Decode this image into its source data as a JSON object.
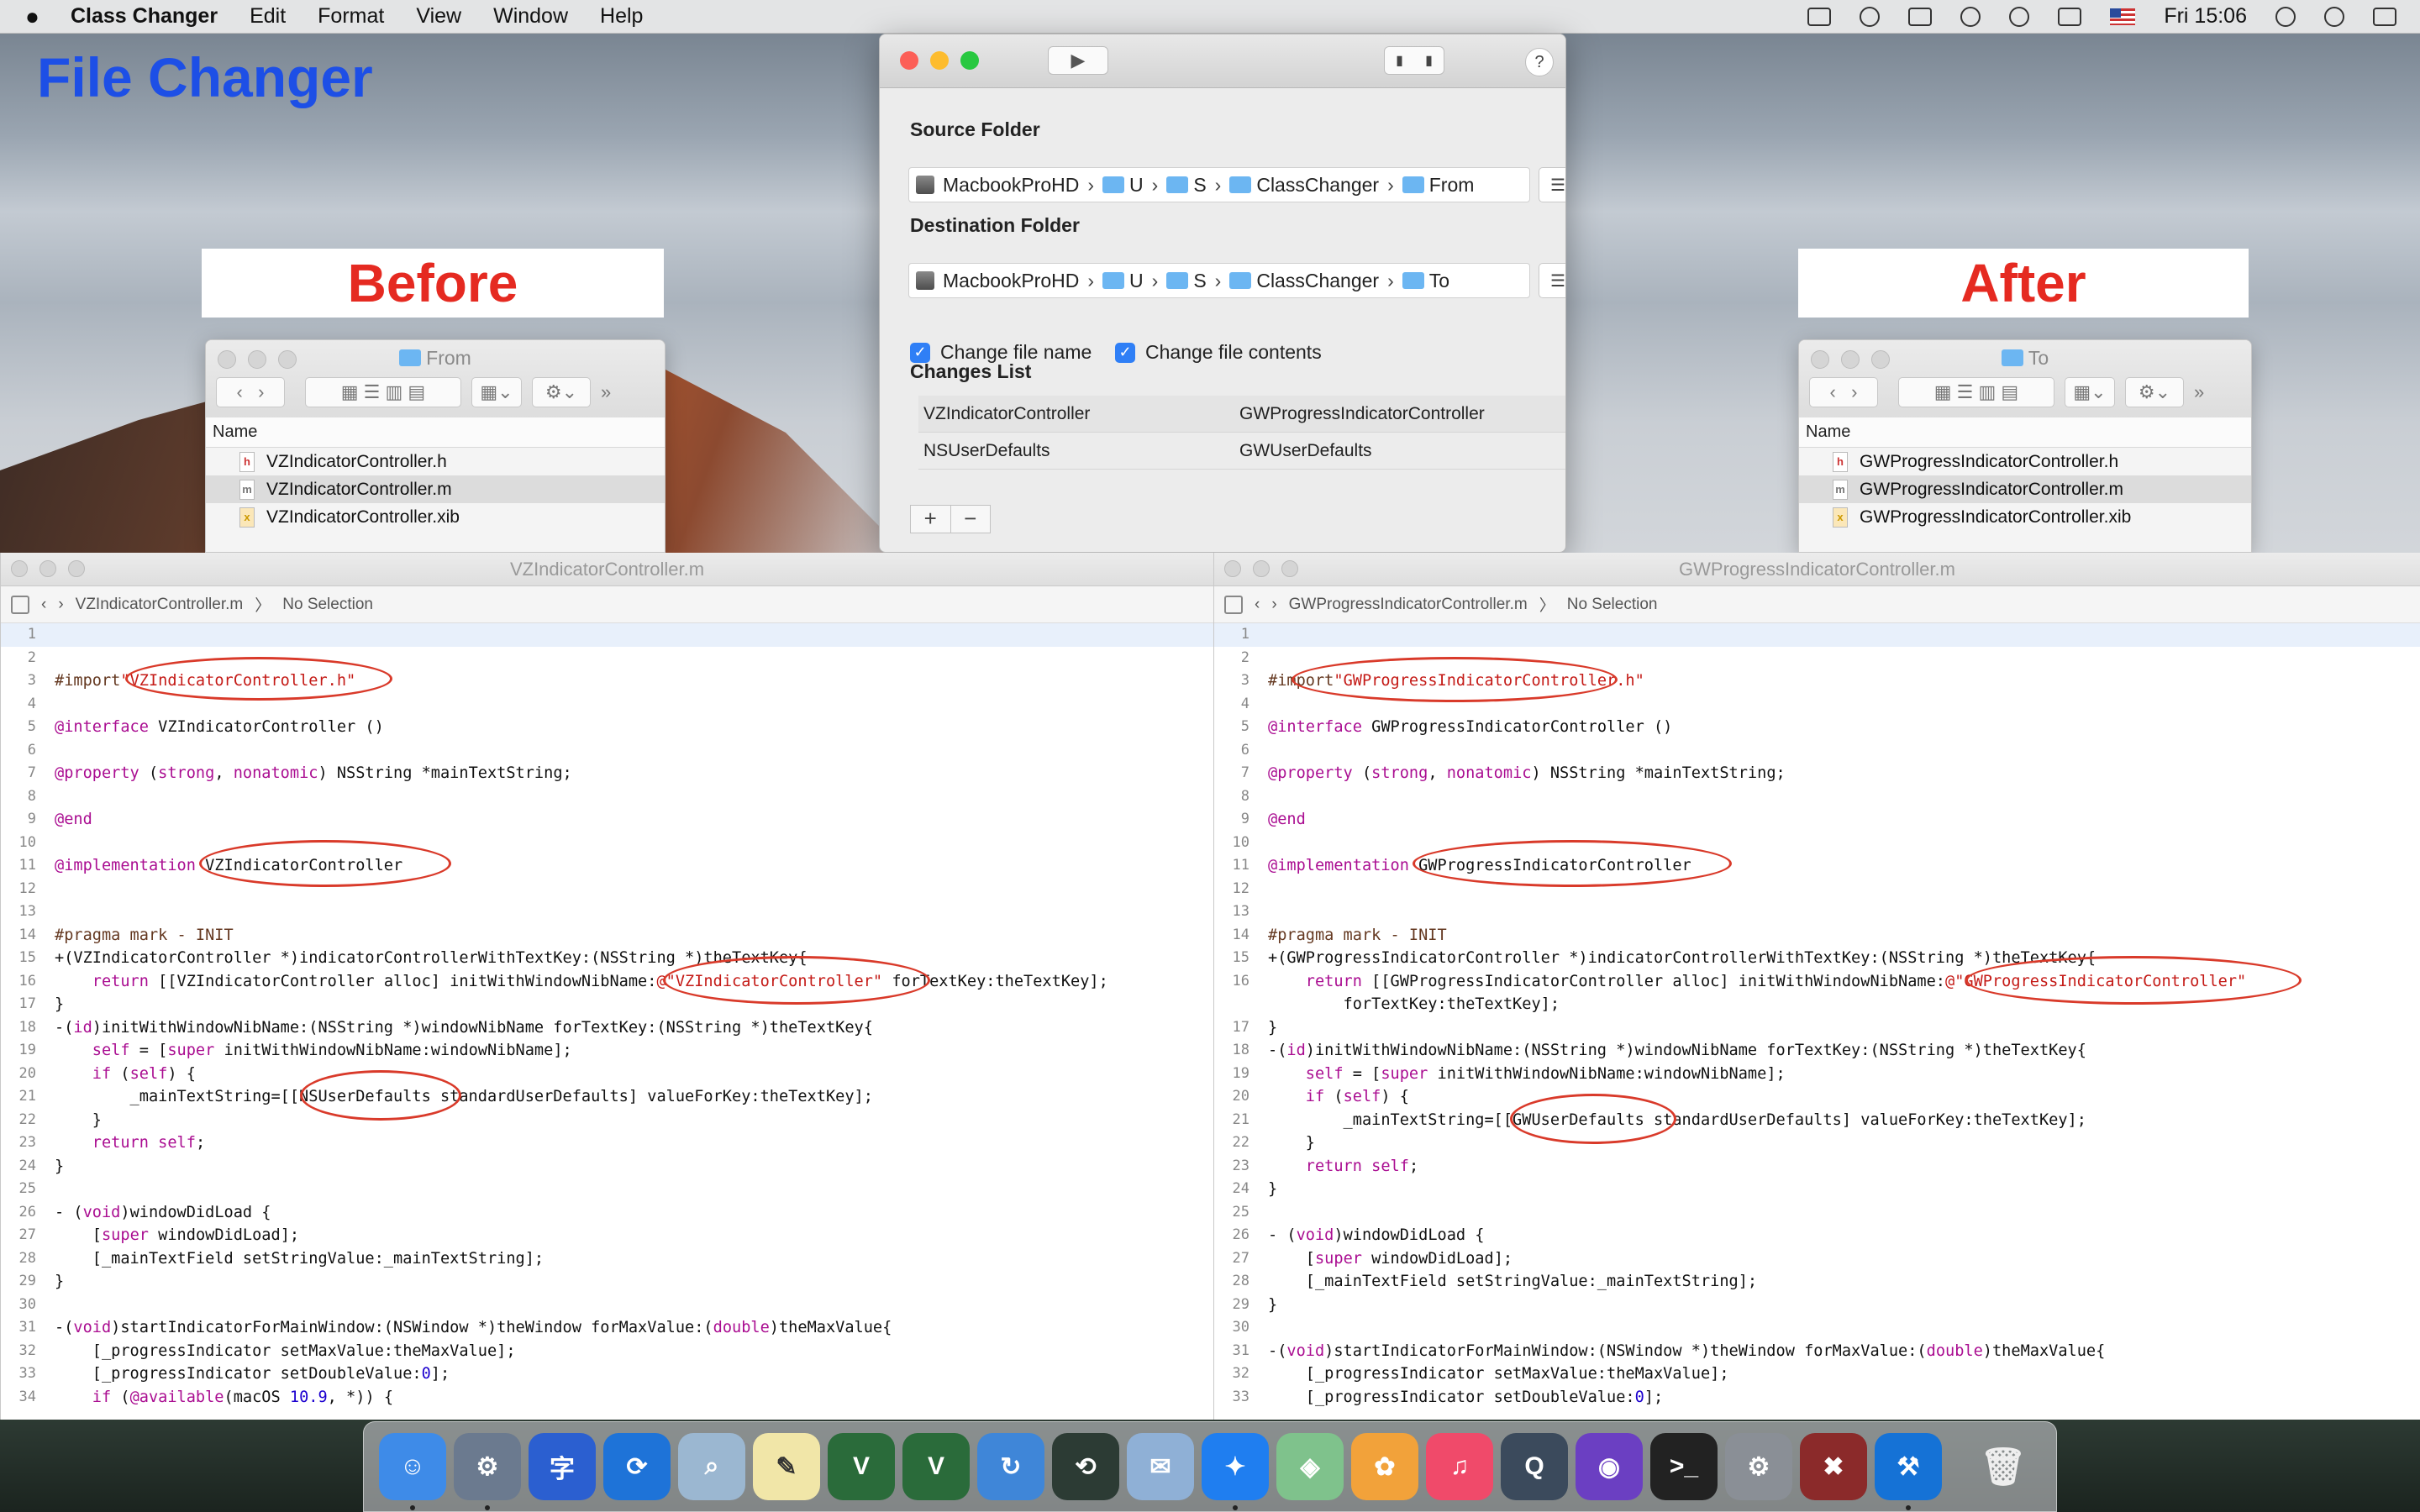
{
  "menubar": {
    "app_name": "Class Changer",
    "items": [
      "Edit",
      "Format",
      "View",
      "Window",
      "Help"
    ],
    "clock": "Fri 15:06"
  },
  "overlay": {
    "title": "File Changer",
    "before": "Before",
    "after": "After"
  },
  "finder_left": {
    "title": "From",
    "column_header": "Name",
    "files": [
      "VZIndicatorController.h",
      "VZIndicatorController.m",
      "VZIndicatorController.xib"
    ]
  },
  "finder_right": {
    "title": "To",
    "column_header": "Name",
    "files": [
      "GWProgressIndicatorController.h",
      "GWProgressIndicatorController.m",
      "GWProgressIndicatorController.xib"
    ]
  },
  "dialog": {
    "source_label": "Source Folder",
    "source_path": [
      "MacbookProHD",
      "U",
      "S",
      "ClassChanger",
      "From"
    ],
    "destination_label": "Destination Folder",
    "destination_path": [
      "MacbookProHD",
      "U",
      "S",
      "ClassChanger",
      "To"
    ],
    "change_file_name": "Change file name",
    "change_file_contents": "Change file contents",
    "changes_label": "Changes List",
    "changes": [
      {
        "from": "VZIndicatorController",
        "to": "GWProgressIndicatorController"
      },
      {
        "from": "NSUserDefaults",
        "to": "GWUserDefaults"
      }
    ],
    "add": "+",
    "remove": "−",
    "help": "?"
  },
  "editor_left": {
    "title": "VZIndicatorController.m",
    "breadcrumb_file": "VZIndicatorController.m",
    "breadcrumb_selection": "No Selection"
  },
  "editor_right": {
    "title": "GWProgressIndicatorController.m",
    "breadcrumb_file": "GWProgressIndicatorController.m",
    "breadcrumb_selection": "No Selection"
  },
  "dock": {
    "icons": [
      "finder-icon",
      "system-preferences-icon",
      "translate-icon",
      "sync-icon",
      "preview-icon",
      "textedit-icon",
      "vpn-icon",
      "vpn-icon-2",
      "refresh-icon",
      "time-machine-icon",
      "mail-icon",
      "safari-icon",
      "maps-icon",
      "photos-icon",
      "music-icon",
      "quicktime-icon",
      "siri-icon",
      "terminal-icon",
      "settings-icon",
      "trash-app-icon",
      "xcode-icon",
      "trash-icon"
    ],
    "colors": {
      "finder": "#3e8be8",
      "safari": "#1f7ef0",
      "xcode": "#1572d6"
    }
  },
  "colors": {
    "title_blue": "#1d4fe6",
    "label_red": "#e52a21",
    "ellipse": "#d93a2a"
  }
}
